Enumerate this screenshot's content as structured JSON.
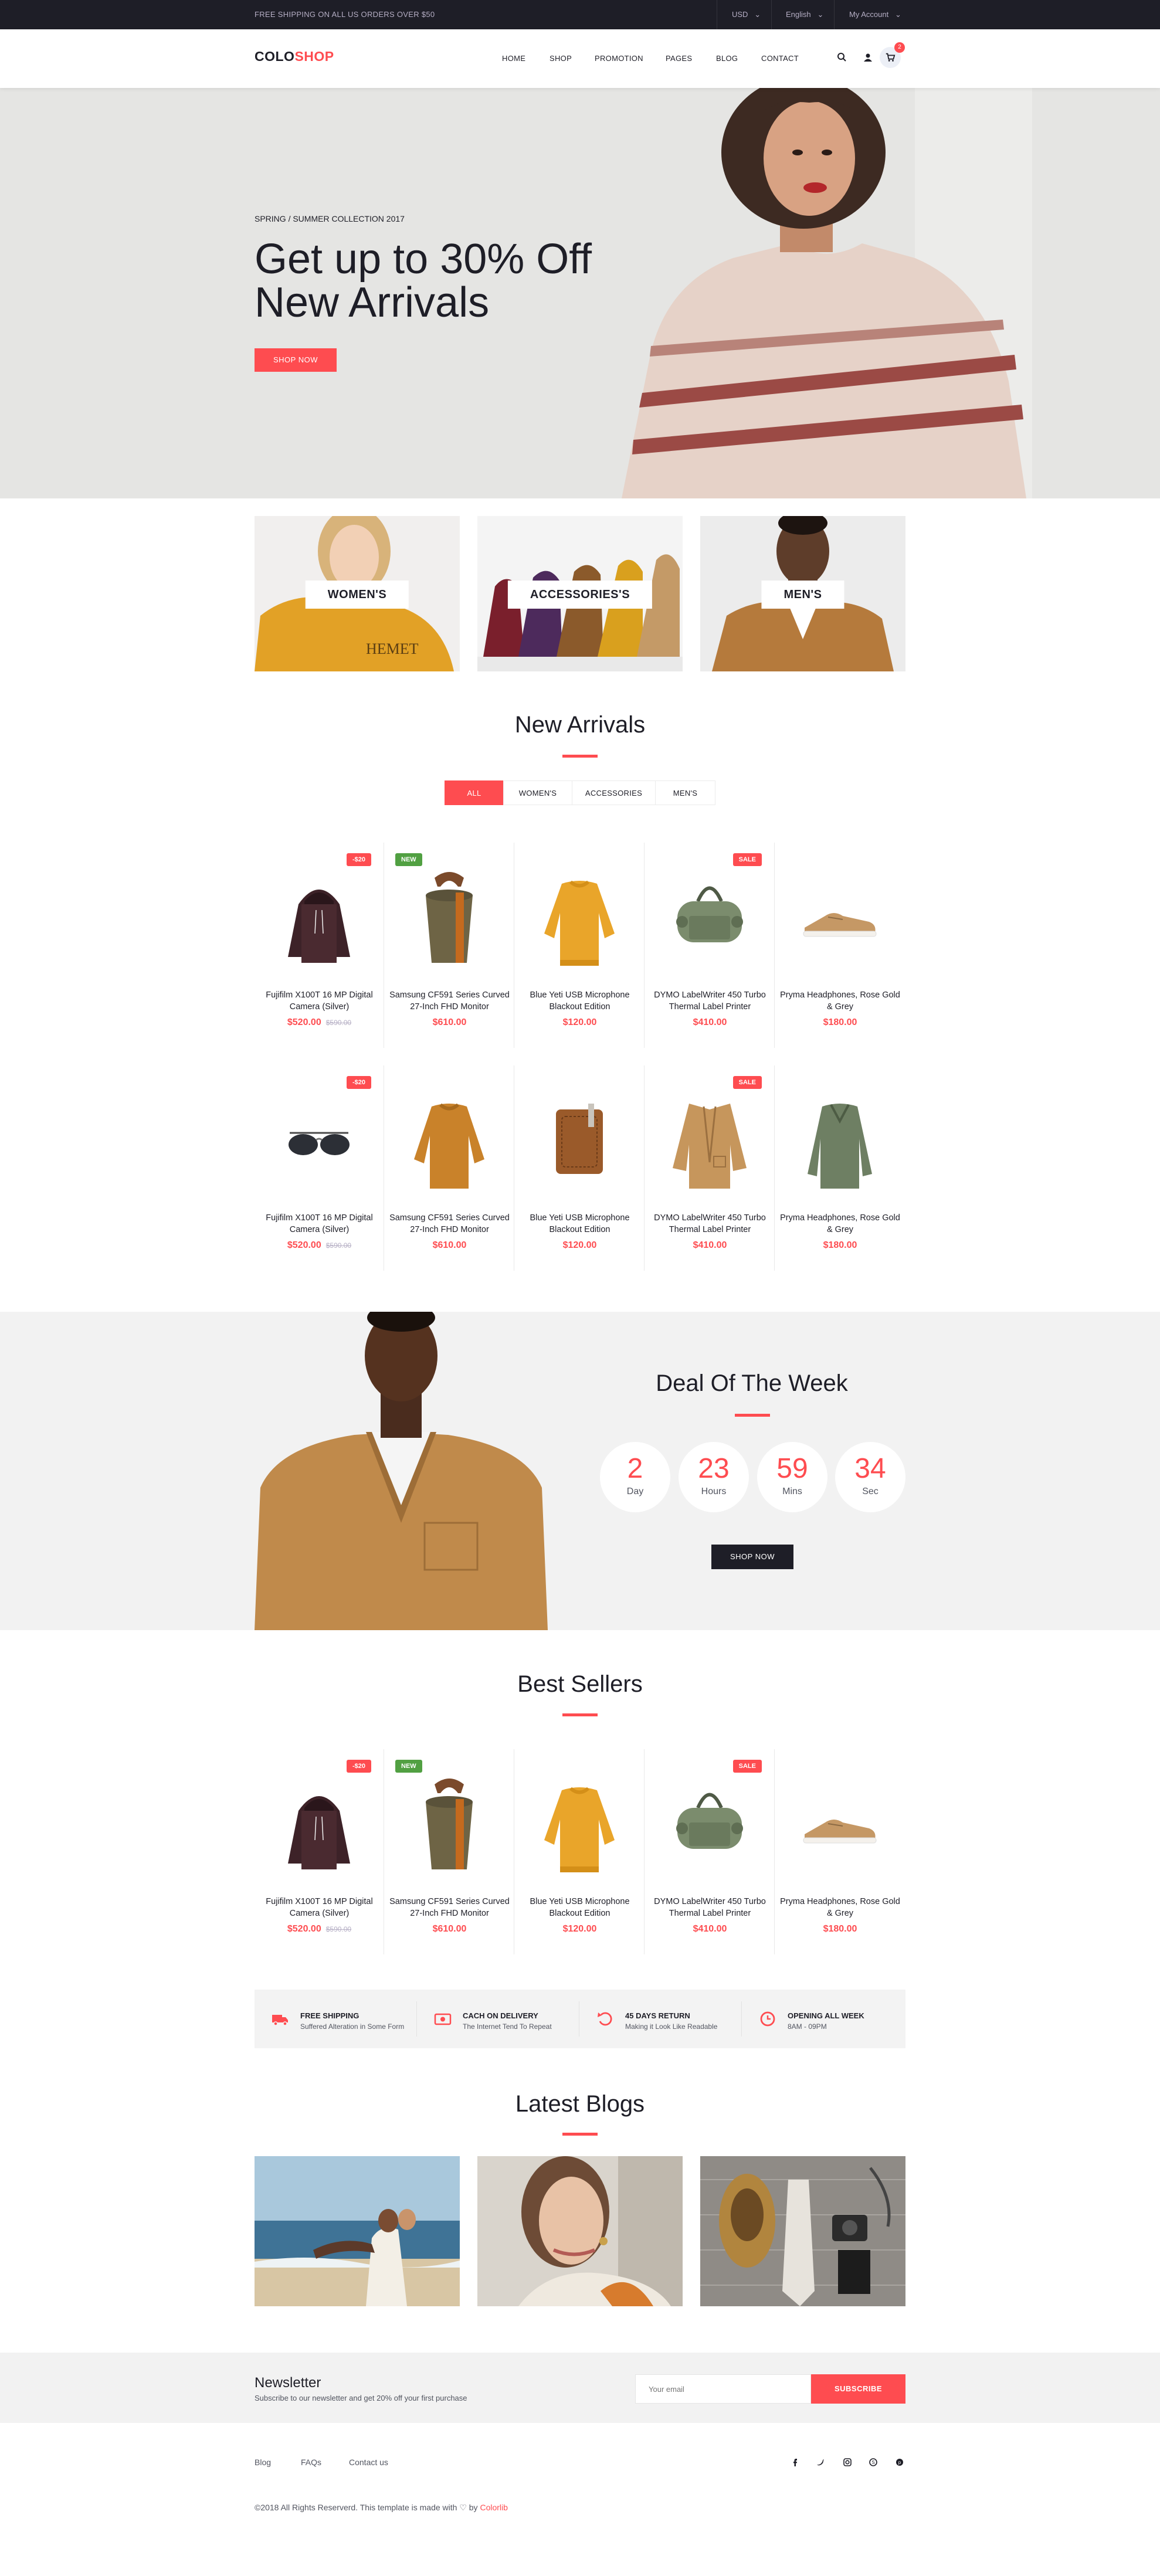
{
  "topbar": {
    "shipping": "FREE SHIPPING ON ALL US ORDERS OVER $50",
    "currency": "USD",
    "language": "English",
    "account": "My Account"
  },
  "header": {
    "logo_a": "COLO",
    "logo_b": "SHOP",
    "nav": [
      "HOME",
      "SHOP",
      "PROMOTION",
      "PAGES",
      "BLOG",
      "CONTACT"
    ],
    "cart_count": "2"
  },
  "hero": {
    "kicker": "SPRING / SUMMER COLLECTION 2017",
    "title_line1": "Get up to 30% Off",
    "title_line2": "New Arrivals",
    "button": "SHOP NOW"
  },
  "categories": [
    "WOMEN'S",
    "ACCESSORIES'S",
    "MEN'S"
  ],
  "new_arrivals": {
    "title": "New Arrivals",
    "tabs": [
      "ALL",
      "WOMEN'S",
      "ACCESSORIES",
      "MEN'S"
    ],
    "products": [
      {
        "name": "Fujifilm X100T 16 MP Digital Camera (Silver)",
        "price": "$520.00",
        "old": "$590.00",
        "badge": "-$20",
        "icon": "hoodie"
      },
      {
        "name": "Samsung CF591 Series Curved 27-Inch FHD Monitor",
        "price": "$610.00",
        "old": "",
        "badge": "NEW",
        "icon": "bucket-bag"
      },
      {
        "name": "Blue Yeti USB Microphone Blackout Edition",
        "price": "$120.00",
        "old": "",
        "badge": "",
        "icon": "sweater"
      },
      {
        "name": "DYMO LabelWriter 450 Turbo Thermal Label Printer",
        "price": "$410.00",
        "old": "",
        "badge": "SALE",
        "icon": "duffel-bag"
      },
      {
        "name": "Pryma Headphones, Rose Gold & Grey",
        "price": "$180.00",
        "old": "",
        "badge": "",
        "icon": "sneaker"
      },
      {
        "name": "Fujifilm X100T 16 MP Digital Camera (Silver)",
        "price": "$520.00",
        "old": "$590.00",
        "badge": "-$20",
        "icon": "sunglasses"
      },
      {
        "name": "Samsung CF591 Series Curved 27-Inch FHD Monitor",
        "price": "$610.00",
        "old": "",
        "badge": "",
        "icon": "knit-sweater"
      },
      {
        "name": "Blue Yeti USB Microphone Blackout Edition",
        "price": "$120.00",
        "old": "",
        "badge": "",
        "icon": "wallet"
      },
      {
        "name": "DYMO LabelWriter 450 Turbo Thermal Label Printer",
        "price": "$410.00",
        "old": "",
        "badge": "SALE",
        "icon": "jacket"
      },
      {
        "name": "Pryma Headphones, Rose Gold & Grey",
        "price": "$180.00",
        "old": "",
        "badge": "",
        "icon": "green-sweater"
      }
    ]
  },
  "deal": {
    "title": "Deal Of The Week",
    "timer": [
      {
        "n": "2",
        "u": "Day"
      },
      {
        "n": "23",
        "u": "Hours"
      },
      {
        "n": "59",
        "u": "Mins"
      },
      {
        "n": "34",
        "u": "Sec"
      }
    ],
    "button": "SHOP NOW"
  },
  "best_sellers": {
    "title": "Best Sellers",
    "products": [
      {
        "name": "Fujifilm X100T 16 MP Digital Camera (Silver)",
        "price": "$520.00",
        "old": "$590.00",
        "badge": "-$20",
        "icon": "hoodie"
      },
      {
        "name": "Samsung CF591 Series Curved 27-Inch FHD Monitor",
        "price": "$610.00",
        "old": "",
        "badge": "NEW",
        "icon": "bucket-bag"
      },
      {
        "name": "Blue Yeti USB Microphone Blackout Edition",
        "price": "$120.00",
        "old": "",
        "badge": "",
        "icon": "sweater"
      },
      {
        "name": "DYMO LabelWriter 450 Turbo Thermal Label Printer",
        "price": "$410.00",
        "old": "",
        "badge": "SALE",
        "icon": "duffel-bag"
      },
      {
        "name": "Pryma Headphones, Rose Gold & Grey",
        "price": "$180.00",
        "old": "",
        "badge": "",
        "icon": "sneaker"
      }
    ]
  },
  "benefits": [
    {
      "title": "FREE SHIPPING",
      "sub": "Suffered Alteration in Some Form",
      "icon": "truck-icon"
    },
    {
      "title": "CACH ON DELIVERY",
      "sub": "The Internet Tend To Repeat",
      "icon": "money-icon"
    },
    {
      "title": "45 DAYS RETURN",
      "sub": "Making it Look Like Readable",
      "icon": "return-icon"
    },
    {
      "title": "OPENING ALL WEEK",
      "sub": "8AM - 09PM",
      "icon": "clock-icon"
    }
  ],
  "blogs": {
    "title": "Latest Blogs"
  },
  "newsletter": {
    "title": "Newsletter",
    "sub": "Subscribe to our newsletter and get 20% off your first purchase",
    "placeholder": "Your email",
    "button": "SUBSCRIBE"
  },
  "footer": {
    "links": [
      "Blog",
      "FAQs",
      "Contact us"
    ],
    "copyright": "©2018 All Rights Reserverd. This template is made with ♡ by",
    "brand": "Colorlib"
  },
  "colors": {
    "accent": "#fe4c50",
    "dark": "#1e1e27",
    "new_badge": "#51a042"
  }
}
